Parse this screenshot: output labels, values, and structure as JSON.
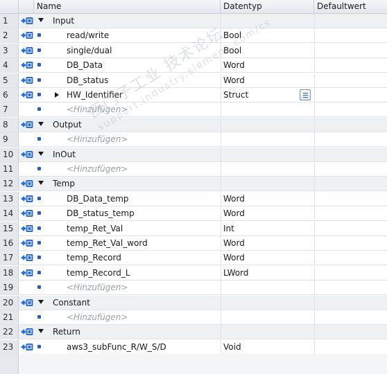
{
  "columns": {
    "name": "Name",
    "datatype": "Datentyp",
    "default": "Defaultwert"
  },
  "rows": [
    {
      "num": "1",
      "name": "Input",
      "type": "",
      "kind": "section",
      "icon": "interface-arrow-icon"
    },
    {
      "num": "2",
      "name": "read/write",
      "type": "Bool",
      "kind": "member",
      "icon": "interface-arrow-icon"
    },
    {
      "num": "3",
      "name": "single/dual",
      "type": "Bool",
      "kind": "member",
      "icon": "interface-arrow-icon"
    },
    {
      "num": "4",
      "name": "DB_Data",
      "type": "Word",
      "kind": "member",
      "icon": "interface-arrow-icon"
    },
    {
      "num": "5",
      "name": "DB_status",
      "type": "Word",
      "kind": "member",
      "icon": "interface-arrow-icon"
    },
    {
      "num": "6",
      "name": "HW_Identifier",
      "type": "Struct",
      "kind": "struct",
      "icon": "interface-arrow-icon"
    },
    {
      "num": "7",
      "name": "<Hinzufügen>",
      "type": "",
      "kind": "add",
      "icon": ""
    },
    {
      "num": "8",
      "name": "Output",
      "type": "",
      "kind": "section",
      "icon": "interface-arrow-icon"
    },
    {
      "num": "9",
      "name": "<Hinzufügen>",
      "type": "",
      "kind": "add",
      "icon": ""
    },
    {
      "num": "10",
      "name": "InOut",
      "type": "",
      "kind": "section",
      "icon": "interface-arrow-icon"
    },
    {
      "num": "11",
      "name": "<Hinzufügen>",
      "type": "",
      "kind": "add",
      "icon": ""
    },
    {
      "num": "12",
      "name": "Temp",
      "type": "",
      "kind": "section",
      "icon": "interface-arrow-icon"
    },
    {
      "num": "13",
      "name": "DB_Data_temp",
      "type": "Word",
      "kind": "member",
      "icon": "interface-arrow-icon"
    },
    {
      "num": "14",
      "name": "DB_status_temp",
      "type": "Word",
      "kind": "member",
      "icon": "interface-arrow-icon"
    },
    {
      "num": "15",
      "name": "temp_Ret_Val",
      "type": "Int",
      "kind": "member",
      "icon": "interface-arrow-icon"
    },
    {
      "num": "16",
      "name": "temp_Ret_Val_word",
      "type": "Word",
      "kind": "member",
      "icon": "interface-arrow-icon"
    },
    {
      "num": "17",
      "name": "temp_Record",
      "type": "Word",
      "kind": "member",
      "icon": "interface-arrow-icon"
    },
    {
      "num": "18",
      "name": "temp_Record_L",
      "type": "LWord",
      "kind": "member",
      "icon": "interface-arrow-icon"
    },
    {
      "num": "19",
      "name": "<Hinzufügen>",
      "type": "",
      "kind": "add",
      "icon": ""
    },
    {
      "num": "20",
      "name": "Constant",
      "type": "",
      "kind": "section",
      "icon": "interface-arrow-icon"
    },
    {
      "num": "21",
      "name": "<Hinzufügen>",
      "type": "",
      "kind": "add",
      "icon": ""
    },
    {
      "num": "22",
      "name": "Return",
      "type": "",
      "kind": "section",
      "icon": "interface-arrow-icon"
    },
    {
      "num": "23",
      "name": "aws3_subFunc_R/W_S/D",
      "type": "Void",
      "kind": "member",
      "icon": "interface-arrow-icon"
    }
  ],
  "watermark": {
    "line1": "西门子工业 技术论坛",
    "line2": "support.industry.siemens.com/cs"
  },
  "colors": {
    "section_bg": "#eef0f2",
    "row_number_bg": "#e4e8ec",
    "bullet": "#2b5fb5",
    "placeholder_text": "#9aa0a6"
  }
}
